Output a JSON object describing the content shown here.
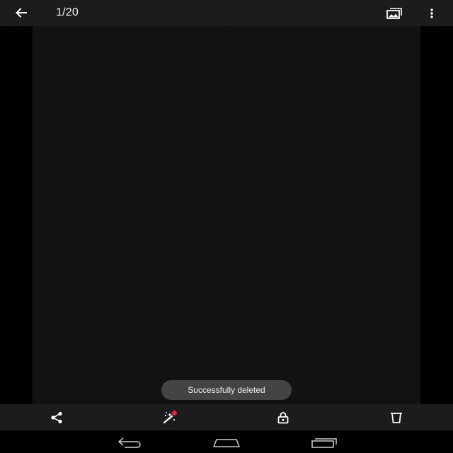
{
  "header": {
    "back_icon": "arrow-left-icon",
    "counter": "1/20",
    "slideshow_icon": "slideshow-icon",
    "more_icon": "more-vert-icon"
  },
  "toast": {
    "message": "Successfully deleted"
  },
  "actions": {
    "share_icon": "share-icon",
    "edit_icon": "magic-wand-icon",
    "lock_icon": "lock-icon",
    "delete_icon": "trash-icon",
    "badge_color": "#e8213a"
  },
  "navigation": {
    "back_icon": "nav-back-icon",
    "home_icon": "nav-home-icon",
    "recents_icon": "nav-recents-icon"
  },
  "colors": {
    "bar_background": "#1b1c1d",
    "photo_background": "#111212",
    "toast_background": "#434443"
  }
}
